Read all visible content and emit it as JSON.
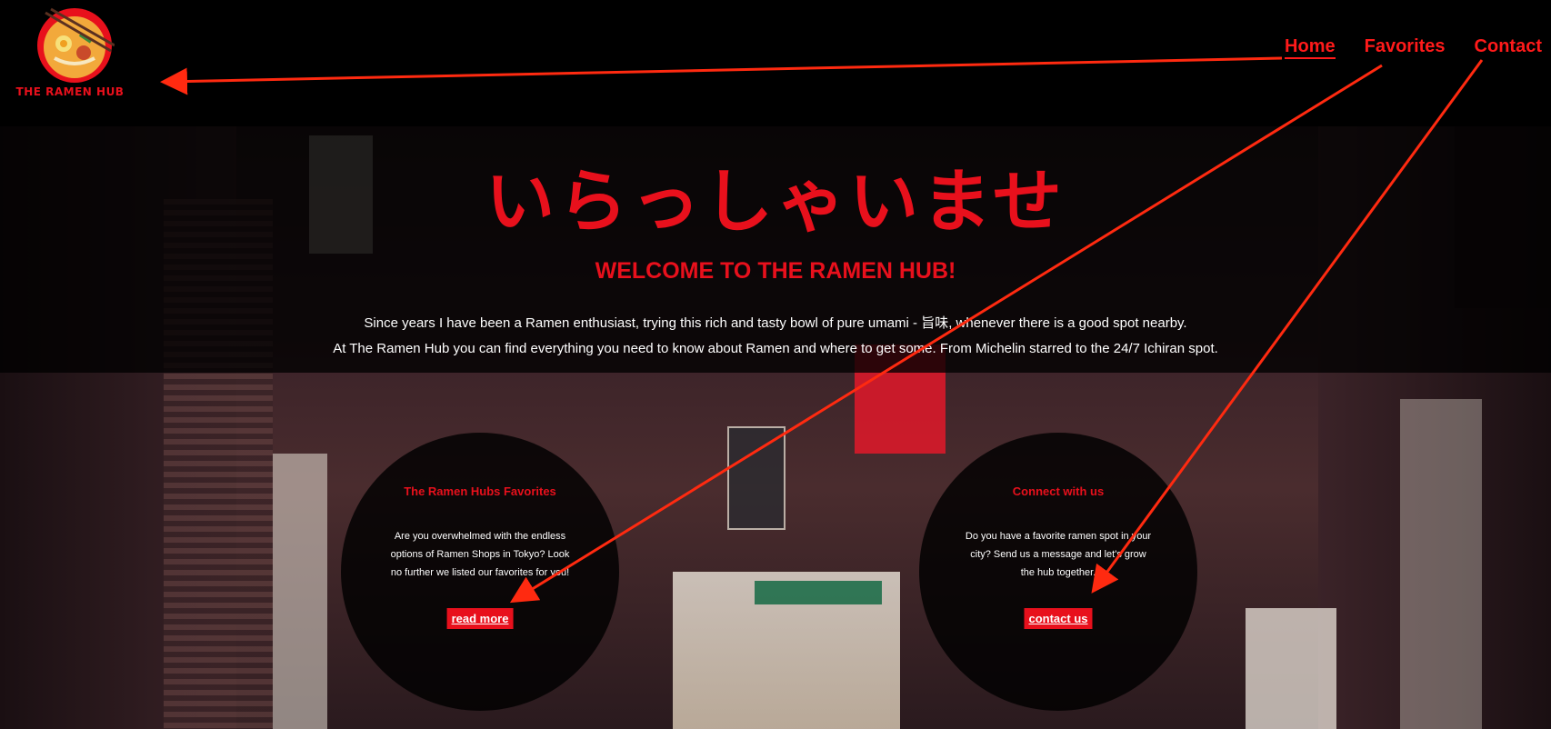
{
  "header": {
    "logo_text": "THE RAMEN HUB",
    "nav": [
      {
        "label": "Home"
      },
      {
        "label": "Favorites"
      },
      {
        "label": "Contact"
      }
    ]
  },
  "hero": {
    "jp_title": "いらっしゃいませ",
    "title": "WELCOME TO THE RAMEN HUB!",
    "intro_line1": "Since years I have been a Ramen enthusiast, trying this rich and tasty bowl of pure umami - 旨味, whenever there is a good spot nearby.",
    "intro_line2": "At The Ramen Hub you can find everything you need to know about Ramen and where to get some. From Michelin starred to the 24/7 Ichiran spot."
  },
  "cards": {
    "favorites": {
      "title": "The Ramen Hubs Favorites",
      "text": "Are you overwhelmed with the endless options of Ramen Shops in Tokyo? Look no further we listed our favorites for you!",
      "cta": "read more"
    },
    "contact": {
      "title": "Connect with us",
      "text": "Do you have a favorite ramen spot in your city? Send us a message and let's grow the hub together.",
      "cta": "contact us"
    }
  },
  "colors": {
    "accent": "#e8101c",
    "arrow": "#ff2a10",
    "background": "#000000"
  }
}
